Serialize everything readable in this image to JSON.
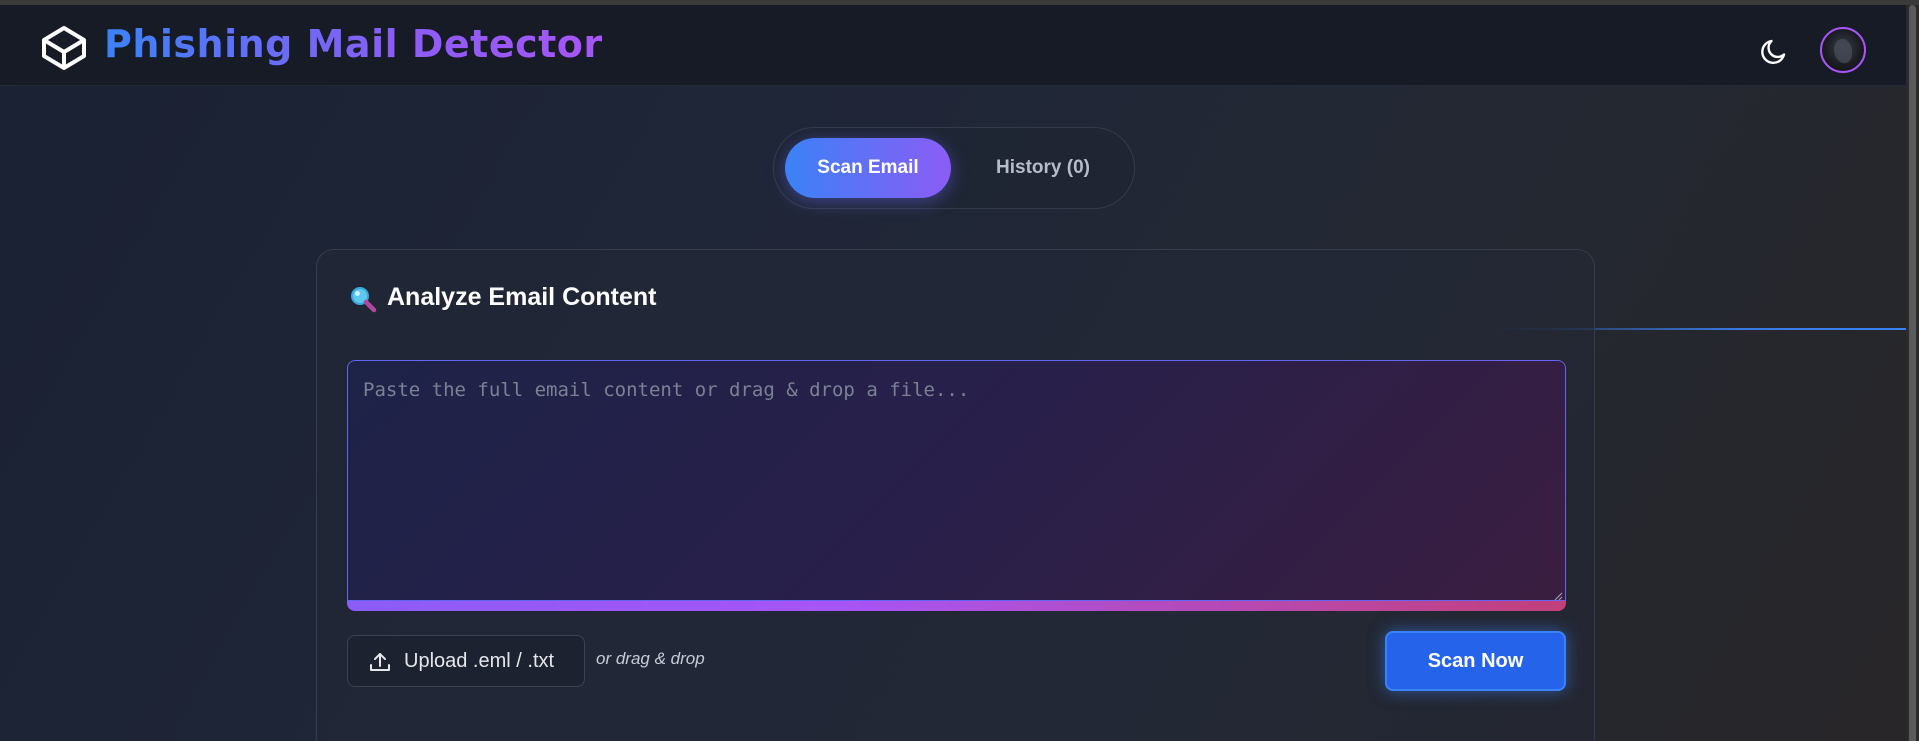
{
  "header": {
    "app_title": "Phishing Mail Detector",
    "logo_icon": "cube-icon",
    "theme_toggle_icon": "moon-icon",
    "avatar": "user-avatar"
  },
  "tabs": [
    {
      "label": "Scan Email",
      "active": true
    },
    {
      "label": "History (0)",
      "active": false
    }
  ],
  "card": {
    "icon": "magnifying-glass-icon",
    "title": "Analyze Email Content",
    "email_input": {
      "placeholder": "Paste the full email content or drag & drop a file...",
      "value": ""
    },
    "upload_button": {
      "label": "Upload .eml / .txt",
      "icon": "upload-icon"
    },
    "drag_hint": "or drag & drop",
    "scan_button": {
      "label": "Scan Now"
    }
  },
  "colors": {
    "accent_blue": "#3b82f6",
    "accent_purple": "#8b5cf6",
    "accent_pink": "#c2407a",
    "header_bg": "#161b26"
  }
}
